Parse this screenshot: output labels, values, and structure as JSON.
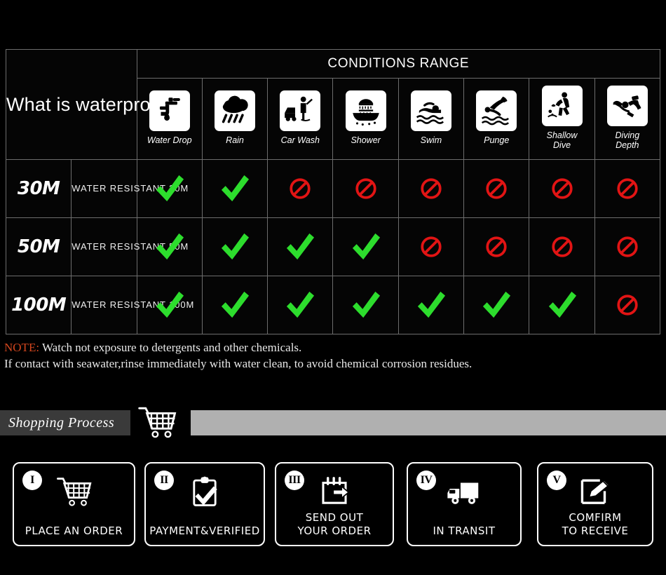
{
  "table": {
    "title": "What is waterproof",
    "conditions_header": "CONDITIONS RANGE",
    "columns": [
      {
        "icon": "faucet-water-drop-icon",
        "label": "Water Drop"
      },
      {
        "icon": "rain-cloud-icon",
        "label": "Rain"
      },
      {
        "icon": "car-wash-icon",
        "label": "Car Wash"
      },
      {
        "icon": "shower-bath-icon",
        "label": "Shower"
      },
      {
        "icon": "swimmer-icon",
        "label": "Swim"
      },
      {
        "icon": "plunge-dive-icon",
        "label": "Punge"
      },
      {
        "icon": "shallow-dive-icon",
        "label": "Shallow\nDive"
      },
      {
        "icon": "scuba-diver-icon",
        "label": "Diving\nDepth"
      }
    ],
    "rows": [
      {
        "depth": "30M",
        "description": "WATER RESISTANT  30M",
        "marks": [
          "check",
          "check",
          "ban",
          "ban",
          "ban",
          "ban",
          "ban",
          "ban"
        ]
      },
      {
        "depth": "50M",
        "description": "WATER RESISTANT 50M",
        "marks": [
          "check",
          "check",
          "check",
          "check",
          "ban",
          "ban",
          "ban",
          "ban"
        ]
      },
      {
        "depth": "100M",
        "description": "WATER RESISTANT  100M",
        "marks": [
          "check",
          "check",
          "check",
          "check",
          "check",
          "check",
          "check",
          "ban"
        ]
      }
    ],
    "colors": {
      "check": "#2ddd2d",
      "ban": "#e21414",
      "grid": "#6d6d6d"
    }
  },
  "note": {
    "label": "NOTE:",
    "line1": " Watch not exposure to detergents and other chemicals.",
    "line2": "If contact with seawater,rinse immediately with water clean, to avoid chemical corrosion residues.",
    "label_color": "#d2461e"
  },
  "shopping_process": {
    "title": "Shopping Process",
    "cart_icon": "shopping-cart-icon",
    "steps": [
      {
        "numeral": "I",
        "icon": "shopping-cart-icon",
        "label": "PLACE AN ORDER"
      },
      {
        "numeral": "II",
        "icon": "clipboard-check-icon",
        "label": "PAYMENT&VERIFIED"
      },
      {
        "numeral": "III",
        "icon": "calendar-arrow-icon",
        "label": "SEND OUT\nYOUR ORDER"
      },
      {
        "numeral": "IV",
        "icon": "delivery-truck-icon",
        "label": "IN TRANSIT"
      },
      {
        "numeral": "V",
        "icon": "edit-pencil-icon",
        "label": "COMFIRM\nTO RECEIVE"
      }
    ]
  }
}
